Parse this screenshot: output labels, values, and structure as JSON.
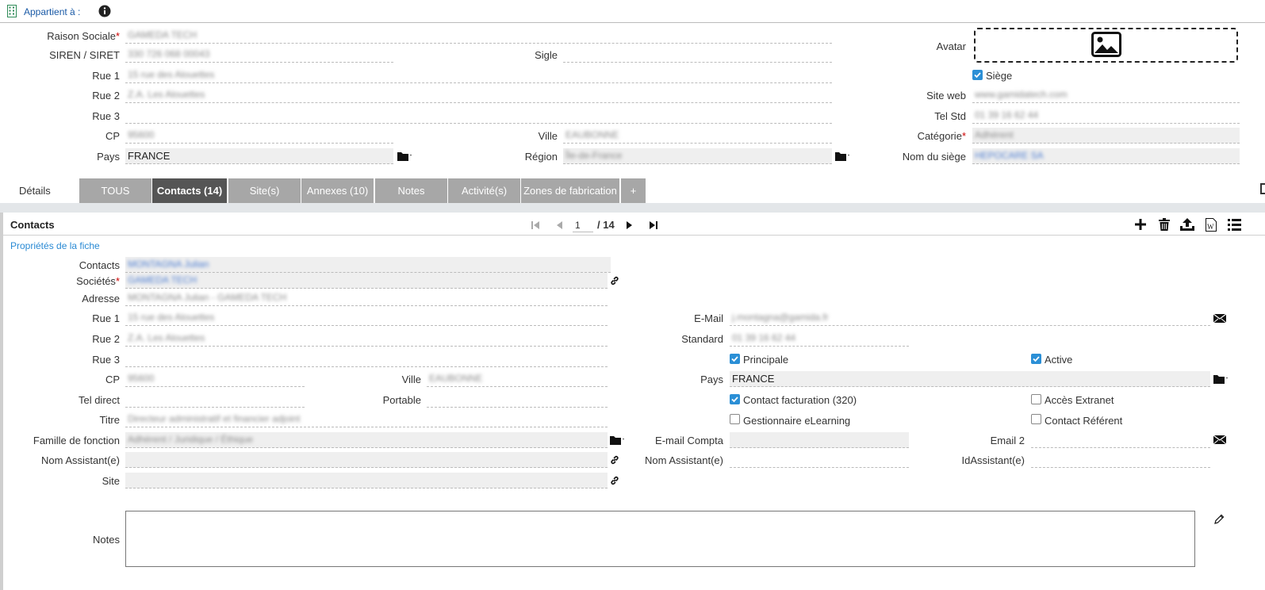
{
  "header": {
    "appartient_label": "Appartient à :"
  },
  "company": {
    "raison_sociale": {
      "label": "Raison Sociale",
      "value": "GAMEDA TECH"
    },
    "siren": {
      "label": "SIREN / SIRET",
      "value": "330 726 068 00043"
    },
    "sigle": {
      "label": "Sigle",
      "value": ""
    },
    "rue1": {
      "label": "Rue 1",
      "value": "15 rue des Alouettes"
    },
    "rue2": {
      "label": "Rue 2",
      "value": "Z.A. Les Alouettes"
    },
    "rue3": {
      "label": "Rue 3",
      "value": ""
    },
    "cp": {
      "label": "CP",
      "value": "95600"
    },
    "ville": {
      "label": "Ville",
      "value": "EAUBONNE"
    },
    "pays": {
      "label": "Pays",
      "value": "FRANCE"
    },
    "region": {
      "label": "Région",
      "value": "Île-de-France"
    },
    "avatar_label": "Avatar",
    "siege_label": "Siège",
    "site_web": {
      "label": "Site web",
      "value": "www.gamidatech.com"
    },
    "tel_std": {
      "label": "Tel Std",
      "value": "01 39 16 62 44"
    },
    "categorie": {
      "label": "Catégorie",
      "value": "Adhérent"
    },
    "nom_siege": {
      "label": "Nom du siège",
      "value": "HEPOCARE SA"
    }
  },
  "tabs": {
    "details": "Détails",
    "items": [
      "TOUS",
      "Contacts (14)",
      "Site(s)",
      "Annexes (10)",
      "Notes",
      "Activité(s)",
      "Zones de fabrication",
      "+"
    ],
    "active": "Contacts (14)"
  },
  "contacts": {
    "title": "Contacts",
    "page_current": "1",
    "page_total": "/ 14",
    "props_link": "Propriétés de la fiche",
    "contacts": {
      "label": "Contacts",
      "value": "MONTAGNA Julian"
    },
    "societes": {
      "label": "Sociétés",
      "value": "GAMEDA TECH"
    },
    "adresse": {
      "label": "Adresse",
      "value": "MONTAGNA Julian - GAMEDA TECH"
    },
    "rue1": {
      "label": "Rue 1",
      "value": "15 rue des Alouettes"
    },
    "rue2": {
      "label": "Rue 2",
      "value": "Z.A. Les Alouettes"
    },
    "rue3": {
      "label": "Rue 3",
      "value": ""
    },
    "cp": {
      "label": "CP",
      "value": "95600"
    },
    "ville": {
      "label": "Ville",
      "value": "EAUBONNE"
    },
    "tel_direct": {
      "label": "Tel direct",
      "value": ""
    },
    "portable": {
      "label": "Portable",
      "value": ""
    },
    "titre": {
      "label": "Titre",
      "value": "Directeur administratif et financier adjoint"
    },
    "famille": {
      "label": "Famille de fonction",
      "value": "Adhérent / Juridique / Éthique"
    },
    "nom_assistant": {
      "label": "Nom Assistant(e)",
      "value": ""
    },
    "site": {
      "label": "Site",
      "value": ""
    },
    "email": {
      "label": "E-Mail",
      "value": "j.montagna@gamida.fr"
    },
    "standard": {
      "label": "Standard",
      "value": "01 39 16 62 44"
    },
    "principale_label": "Principale",
    "active_label": "Active",
    "pays": {
      "label": "Pays",
      "value": "FRANCE"
    },
    "contact_facturation_label": "Contact facturation (320)",
    "acces_extranet_label": "Accès Extranet",
    "gestionnaire_label": "Gestionnaire eLearning",
    "contact_referent_label": "Contact Référent",
    "email_compta": {
      "label": "E-mail Compta",
      "value": ""
    },
    "email2": {
      "label": "Email 2",
      "value": ""
    },
    "nom_assistant2": {
      "label": "Nom Assistant(e)",
      "value": ""
    },
    "id_assistant": {
      "label": "IdAssistant(e)",
      "value": ""
    },
    "notes_label": "Notes",
    "notes_value": ""
  }
}
